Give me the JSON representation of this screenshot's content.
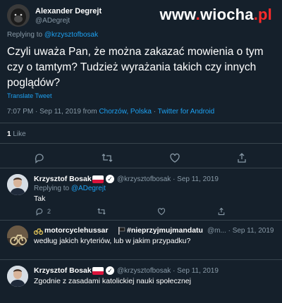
{
  "watermark": {
    "prefix": "www",
    "dot": ".",
    "name": "wiocha",
    "tld": ".pl"
  },
  "main_tweet": {
    "author_name": "Alexander Degrejt",
    "author_handle": "@ADegrejt",
    "replying_prefix": "Replying to ",
    "replying_to": "@krzysztofbosak",
    "text": "Czyli uważa Pan, że można zakazać mowienia o tym czy o tamtym? Tudzież wyrażania takich czy innych poglądów?",
    "translate_label": "Translate Tweet",
    "time": "7:07 PM · Sep 11, 2019 from ",
    "location": "Chorzów, Polska",
    "sep": " · ",
    "source": "Twitter for Android",
    "likes_count": "1",
    "likes_label": " Like"
  },
  "replies": [
    {
      "author_name": "Krzysztof Bosak",
      "author_handle": "@krzysztofbosak · Sep 11, 2019",
      "replying_prefix": "Replying to ",
      "replying_to": "@ADegrejt",
      "text": "Tak",
      "reply_count": "2"
    },
    {
      "author_name": "motorcyclehussar",
      "author_extra": "#nieprzyjmujmandatu",
      "author_handle": "@m... · Sep 11, 2019",
      "text": "według jakich kryteriów, lub w jakim przypadku?"
    },
    {
      "author_name": "Krzysztof Bosak",
      "author_handle": "@krzysztofbosak · Sep 11, 2019",
      "text": "Zgodnie z zasadami katolickiej nauki społecznej"
    }
  ],
  "colors": {
    "background": "#15202b",
    "accent": "#1da1f2",
    "muted": "#8899a6",
    "like": "#e0245e",
    "divider": "#38444d"
  },
  "icons": [
    "avatar-gorilla",
    "reply-icon",
    "retweet-icon",
    "like-icon",
    "share-icon",
    "verified-icon",
    "poland-flag-icon",
    "more-icon"
  ]
}
